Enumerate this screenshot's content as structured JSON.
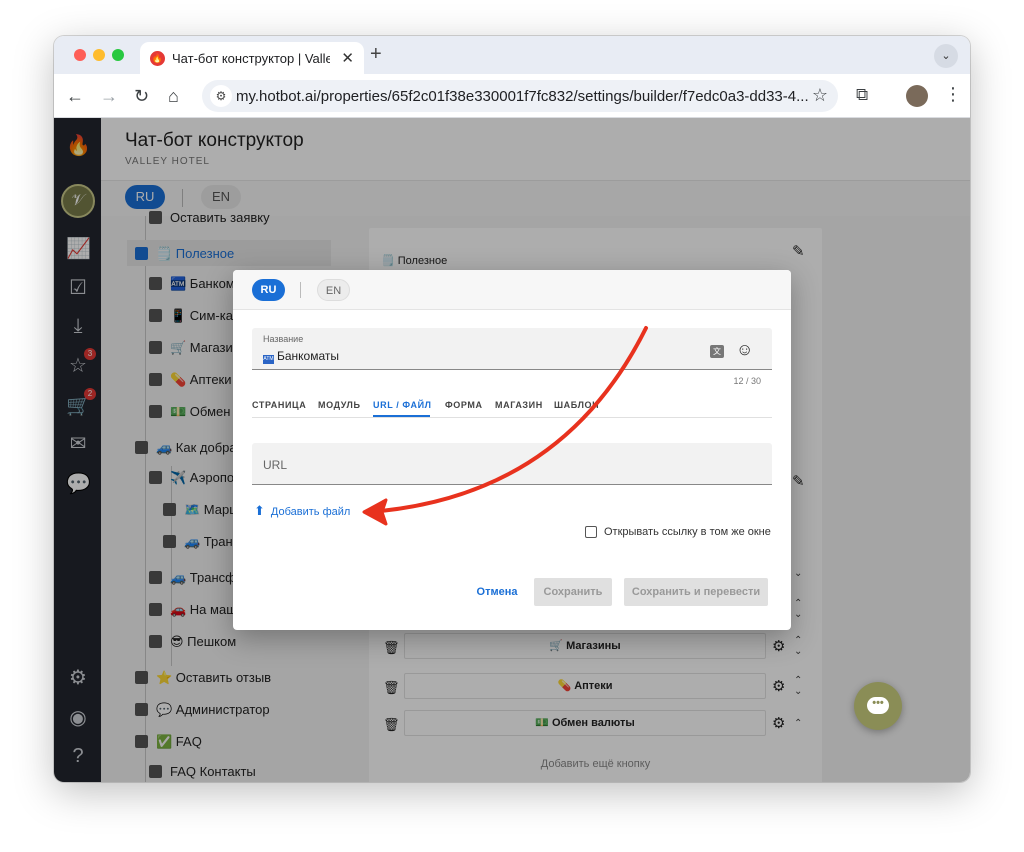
{
  "browser": {
    "tab_title": "Чат-бот конструктор | Valley Hotel",
    "url": "my.hotbot.ai/properties/65f2c01f38e330001f7fc832/settings/builder/f7edc0a3-dd33-4..."
  },
  "sidebar": {
    "badges": [
      "3",
      "2"
    ]
  },
  "header": {
    "title": "Чат-бот конструктор",
    "subtitle": "VALLEY HOTEL"
  },
  "langs": [
    "RU",
    "EN"
  ],
  "tree": {
    "items": [
      "Оставить заявку",
      "🗒️ Полезное",
      "🏧 Банкома",
      "📱 Сим-кар",
      "🛒 Магазин",
      "💊 Аптеки",
      "💵 Обмен в",
      "🚙 Как добра",
      "✈️ Аэропор",
      "🗺️ Маршр",
      "🚙 Транс",
      "🚙 Трансфе",
      "🚗 На маши",
      "😎 Пешком",
      "⭐ Оставить отзыв",
      "💬 Администратор",
      "✅ FAQ",
      "FAQ Контакты"
    ]
  },
  "card": {
    "title": "🗒️ Полезное",
    "buttons": [
      "🛒 Магазины",
      "💊 Аптеки",
      "💵 Обмен валюты"
    ],
    "add_more": "Добавить ещё кнопку"
  },
  "dialog": {
    "langs": [
      "RU",
      "EN"
    ],
    "name_label": "Название",
    "name_value": "Банкоматы",
    "counter": "12 / 30",
    "tabs": [
      "СТРАНИЦА",
      "МОДУЛЬ",
      "URL / ФАЙЛ",
      "ФОРМА",
      "МАГАЗИН",
      "ШАБЛОН"
    ],
    "url_placeholder": "URL",
    "add_file": "Добавить файл",
    "open_same_window": "Открывать ссылку в том же окне",
    "cancel": "Отмена",
    "save": "Сохранить",
    "save_translate": "Сохранить и перевести"
  },
  "colors": {
    "accent": "#1a6fd6",
    "sidebar": "#22262e",
    "arrow": "#e8321e",
    "chat_fab": "#8a8d56"
  }
}
